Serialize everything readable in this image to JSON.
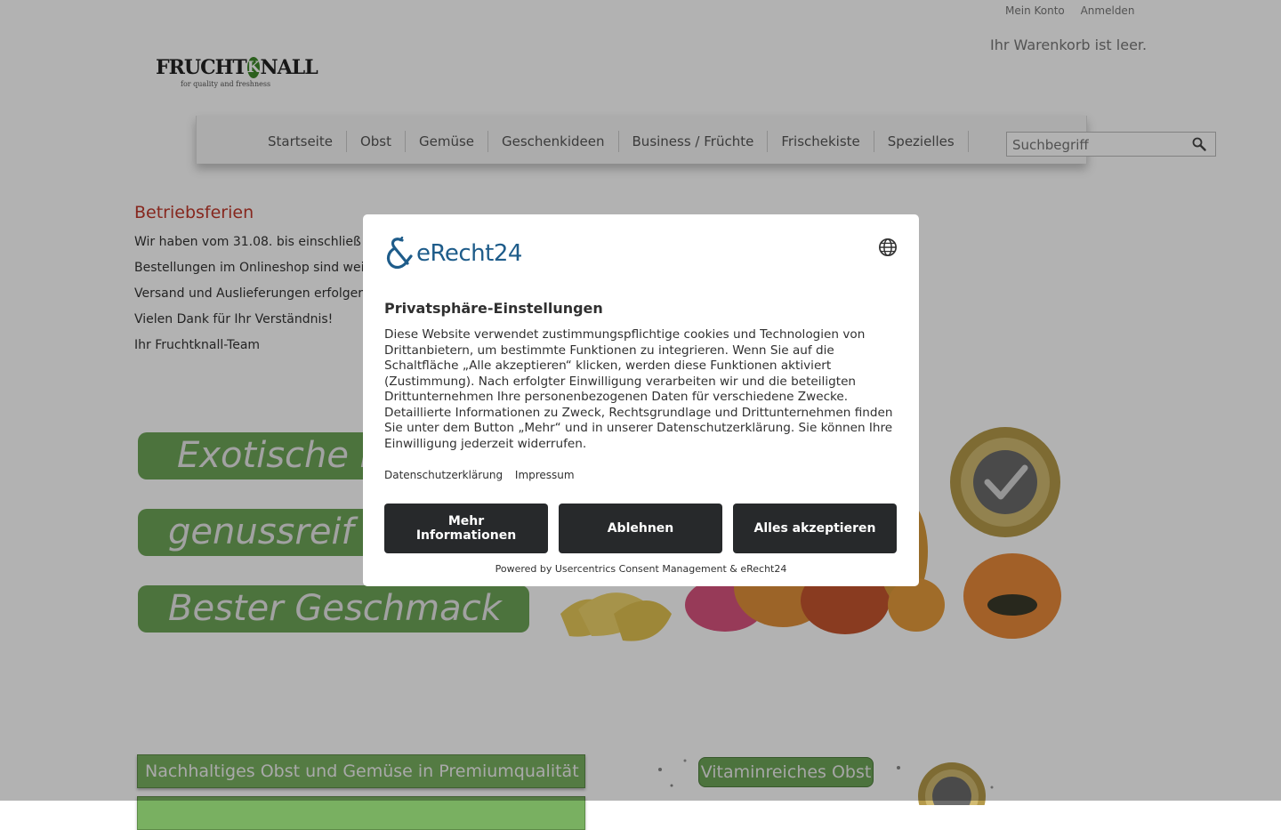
{
  "header": {
    "account_link": "Mein Konto",
    "login_link": "Anmelden",
    "cart_status": "Ihr Warenkorb ist leer.",
    "logo": {
      "word_left": "FRUCHT",
      "word_k": "K",
      "word_right": "NALL",
      "tagline": "for quality and freshness"
    }
  },
  "nav": {
    "items": [
      {
        "label": "Startseite"
      },
      {
        "label": "Obst"
      },
      {
        "label": "Gemüse"
      },
      {
        "label": "Geschenkideen"
      },
      {
        "label": "Business / Früchte"
      },
      {
        "label": "Frischekiste"
      },
      {
        "label": "Spezielles"
      }
    ],
    "search_placeholder": "Suchbegriff"
  },
  "notice": {
    "title": "Betriebsferien",
    "lines": [
      "Wir haben vom 31.08. bis einschließ",
      "Bestellungen im Onlineshop sind wei",
      "Versand und Auslieferungen erfolger",
      "Vielen Dank für Ihr Verständnis!",
      "Ihr Fruchtknall-Team"
    ]
  },
  "banner": {
    "pills": [
      "Exotische F",
      "genussreif",
      "Bester Geschmack"
    ]
  },
  "bottom": {
    "bar1": "Nachhaltiges Obst und Gemüse in Premiumqualität",
    "vitamin_label": "Vitaminreiches Obst"
  },
  "consent": {
    "brand": "eRecht24",
    "title": "Privatsphäre-Einstellungen",
    "body": "Diese Website verwendet zustimmungspflichtige cookies und Technologien von Drittanbietern, um bestimmte Funktionen zu integrieren. Wenn Sie auf die Schaltfläche „Alle akzeptieren“ klicken, werden diese Funktionen aktiviert (Zustimmung). Nach erfolgter Einwilligung verarbeiten wir und die beteiligten Drittunternehmen Ihre personenbezogenen Daten für verschiedene Zwecke. Detaillierte Informationen zu Zweck, Rechtsgrundlage und Drittunternehmen finden Sie unter dem Button „Mehr“ und in unserer Datenschutzerklärung. Sie können Ihre Einwilligung jederzeit widerrufen.",
    "link_privacy": "Datenschutzerklärung",
    "link_imprint": "Impressum",
    "btn_more": "Mehr Informationen",
    "btn_deny": "Ablehnen",
    "btn_accept": "Alles akzeptieren",
    "powered_by": "Powered by Usercentrics Consent Management & eRecht24"
  },
  "colors": {
    "accent_green": "#6ea558",
    "notice_red": "#c0392b",
    "button_dark": "#27292b",
    "brand_blue": "#1e5c8a"
  }
}
